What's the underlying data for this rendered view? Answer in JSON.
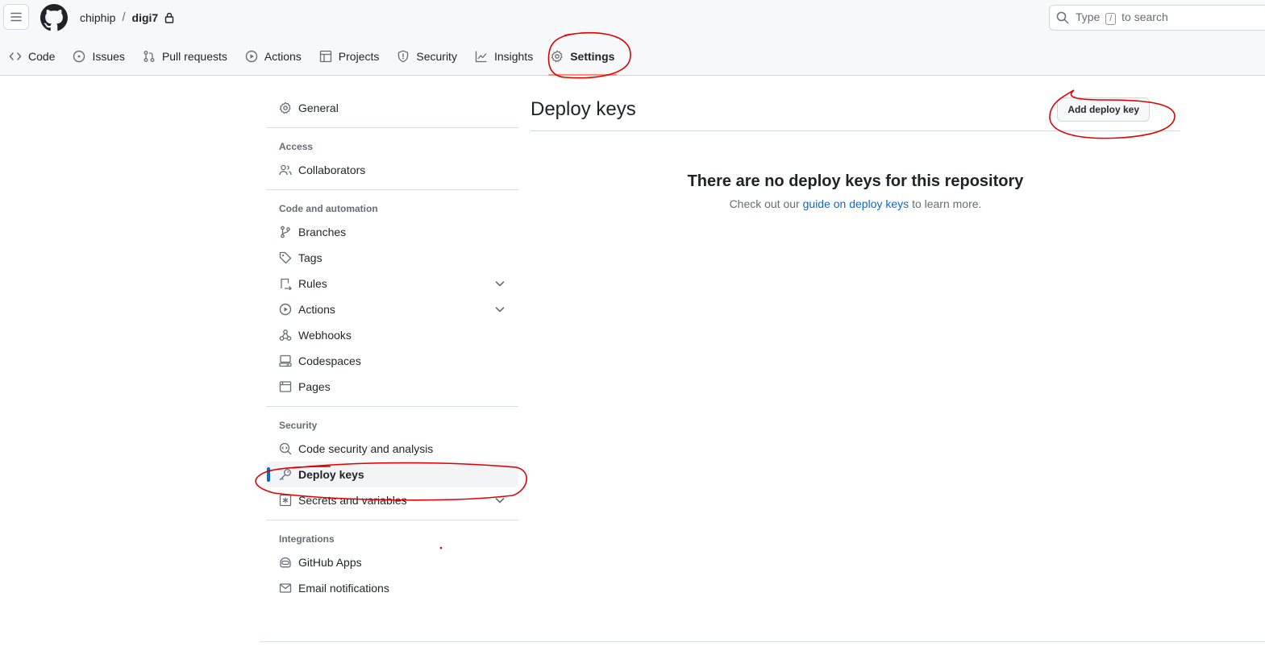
{
  "header": {
    "owner": "chiphip",
    "separator": "/",
    "repo": "digi7",
    "search_prefix": "Type",
    "search_key": "/",
    "search_suffix": "to search"
  },
  "tabs": [
    {
      "label": "Code",
      "icon": "code-icon"
    },
    {
      "label": "Issues",
      "icon": "issue-opened-icon"
    },
    {
      "label": "Pull requests",
      "icon": "git-pull-request-icon"
    },
    {
      "label": "Actions",
      "icon": "play-icon"
    },
    {
      "label": "Projects",
      "icon": "table-icon"
    },
    {
      "label": "Security",
      "icon": "shield-icon"
    },
    {
      "label": "Insights",
      "icon": "graph-icon"
    },
    {
      "label": "Settings",
      "icon": "gear-icon",
      "selected": true
    }
  ],
  "sidebar": {
    "general": "General",
    "access_heading": "Access",
    "collaborators": "Collaborators",
    "code_heading": "Code and automation",
    "branches": "Branches",
    "tags": "Tags",
    "rules": "Rules",
    "actions": "Actions",
    "webhooks": "Webhooks",
    "codespaces": "Codespaces",
    "pages": "Pages",
    "security_heading": "Security",
    "code_security": "Code security and analysis",
    "deploy_keys": "Deploy keys",
    "secrets": "Secrets and variables",
    "integrations_heading": "Integrations",
    "github_apps": "GitHub Apps",
    "email_notifications": "Email notifications"
  },
  "main": {
    "title": "Deploy keys",
    "add_button": "Add deploy key",
    "blank_title": "There are no deploy keys for this repository",
    "blank_pre": "Check out our",
    "blank_link": "guide on deploy keys",
    "blank_post": "to learn more."
  },
  "colors": {
    "accent": "#0969da",
    "annotation": "#e00000",
    "selected_tab_underline": "#fd8c73"
  }
}
